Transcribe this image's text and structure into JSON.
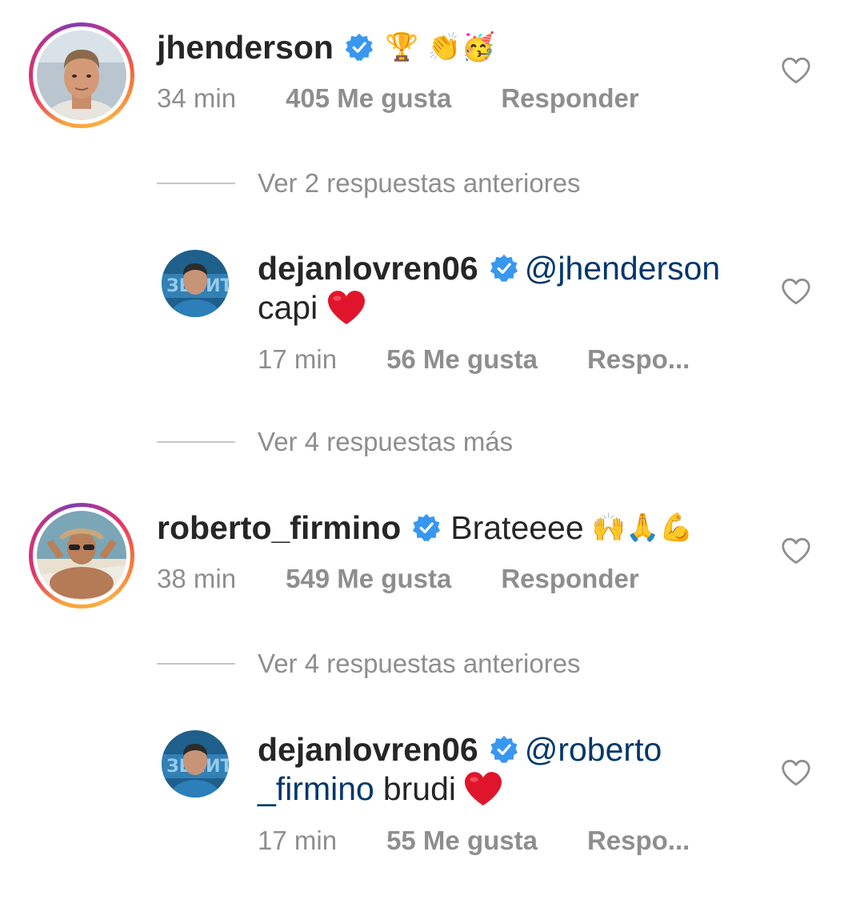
{
  "colors": {
    "text": "#262626",
    "muted": "#8e8e8e",
    "mention": "#00376b",
    "verified": "#3897f0",
    "heart_red": "#e0152b"
  },
  "comments": [
    {
      "username": "jhenderson",
      "verified": true,
      "text": "",
      "emoji": "🏆 👏🥳",
      "time": "34 min",
      "likes": "405 Me gusta",
      "reply": "Responder",
      "has_story_ring": true,
      "avatar_icon": "avatar-photo-man-blond"
    },
    {
      "view_replies": "Ver 2 respuestas anteriores"
    },
    {
      "username": "dejanlovren06",
      "verified": true,
      "mention": "@jhenderson",
      "text": "capi",
      "emoji": "❤",
      "time": "17 min",
      "likes": "56 Me gusta",
      "reply": "Respo...",
      "avatar_icon": "avatar-photo-zenit-player"
    },
    {
      "view_replies": "Ver 4 respuestas más"
    },
    {
      "username": "roberto_firmino",
      "verified": true,
      "text": "Brateeee",
      "emoji": "🙌🙏💪",
      "time": "38 min",
      "likes": "549 Me gusta",
      "reply": "Responder",
      "has_story_ring": true,
      "avatar_icon": "avatar-photo-man-hat"
    },
    {
      "view_replies": "Ver 4 respuestas anteriores"
    },
    {
      "username": "dejanlovren06",
      "verified": true,
      "mention_line1": "@roberto",
      "mention_line2": "_firmino",
      "text": "brudi",
      "emoji": "❤",
      "time": "17 min",
      "likes": "55 Me gusta",
      "reply": "Respo...",
      "avatar_icon": "avatar-photo-zenit-player"
    }
  ]
}
